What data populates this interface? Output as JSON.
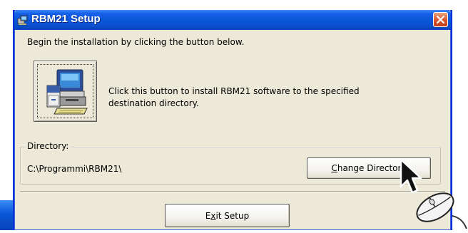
{
  "window": {
    "title": "RBM21 Setup"
  },
  "main": {
    "instruction": "Begin the installation by clicking the button below.",
    "install_description": "Click this button to install RBM21 software to the specified destination directory."
  },
  "directory": {
    "legend": "Directory:",
    "path": "C:\\Programmi\\RBM21\\",
    "change_button": "Change Directory",
    "change_mnemonic": "C"
  },
  "footer": {
    "exit_button": "Exit Setup",
    "exit_mnemonic": "x"
  },
  "icons": {
    "title": "setup-computer-icon",
    "close": "close-icon",
    "install": "computer-install-icon",
    "cursor": "mouse-pointer-icon",
    "mouse": "computer-mouse-icon"
  },
  "colors": {
    "titlebar": "#0a57d8",
    "window_bg": "#ece9d8",
    "close_button": "#d9542c"
  }
}
